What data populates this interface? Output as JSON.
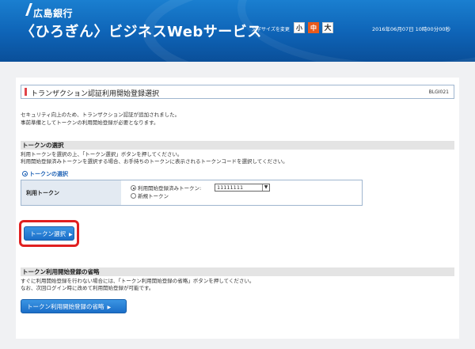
{
  "header": {
    "bank_name": "広島銀行",
    "service_title": "〈ひろぎん〉ビジネスWebサービス",
    "font_size_label": "文字サイズを変更",
    "font_small": "小",
    "font_medium": "中",
    "font_large": "大",
    "datetime": "2016年06月07日 10時00分00秒"
  },
  "page": {
    "title": "トランザクション認証利用開始登録選択",
    "screen_code": "BLGI021",
    "intro_line1": "セキュリティ向上のため、トランザクション認証が追加されました。",
    "intro_line2": "事前準備としてトークンの利用開始登録が必要となります。"
  },
  "token_section": {
    "heading": "トークンの選択",
    "desc_line1": "利用トークンを選択の上、「トークン選択」ボタンを押してください。",
    "desc_line2": "利用開始登録済みトークンを選択する場合、お手持ちのトークンに表示されるトークンコードを選択してください。",
    "subheading": "トークンの選択",
    "field_label": "利用トークン",
    "option_registered": "利用開始登録済みトークン:",
    "selected_token": "11111111",
    "option_new": "新規トークン",
    "button_label": "トークン選択"
  },
  "skip_section": {
    "heading": "トークン利用開始登録の省略",
    "desc_line1": "すぐに利用開始登録を行わない場合には、「トークン利用開始登録の省略」ボタンを押してください。",
    "desc_line2": "なお、次回ログイン時に改めて利用開始登録が可能です。",
    "button_label": "トークン利用開始登録の省略"
  },
  "colors": {
    "header_blue": "#0e63b6",
    "accent_red": "#e02020",
    "font_medium_orange": "#e85a1b"
  }
}
